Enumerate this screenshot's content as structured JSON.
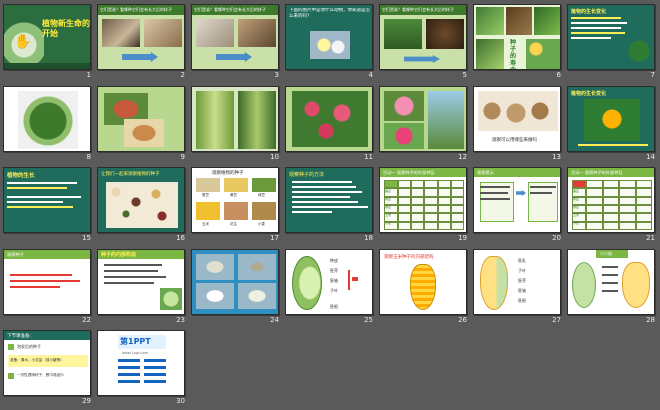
{
  "slides": [
    {
      "num": "1",
      "title": "植物新生命的开始"
    },
    {
      "num": "2",
      "title": "它们是谁？看哪种它们会有长大后的样子"
    },
    {
      "num": "3",
      "title": "它们是谁？看哪种它们会有长大后的样子"
    },
    {
      "num": "4",
      "title": "下面的图片中是你什么动物，你知道是怎么来的吗？"
    },
    {
      "num": "5",
      "title": "它们是谁？看哪种它们会有长大后的样子"
    },
    {
      "num": "6",
      "title": "种子的寿命"
    },
    {
      "num": "7",
      "title": "植物的生长变化"
    },
    {
      "num": "8"
    },
    {
      "num": "9"
    },
    {
      "num": "10"
    },
    {
      "num": "11"
    },
    {
      "num": "12"
    },
    {
      "num": "13",
      "caption": "观察可以用哪些来做吗"
    },
    {
      "num": "14",
      "title": "植物的生长变化"
    },
    {
      "num": "15",
      "title": "植物的生长"
    },
    {
      "num": "16",
      "title": "让我们一起来观察植物的种子"
    },
    {
      "num": "17",
      "title": "观察植物的种子",
      "labels": [
        "蚕豆",
        "黄豆",
        "绿豆",
        "玉米",
        "花生",
        "小麦"
      ]
    },
    {
      "num": "18",
      "title": "观察种子的方法"
    },
    {
      "num": "19",
      "title": "活动一  观察种子的外部特征",
      "rows": [
        "蚕豆",
        "黄豆",
        "绿豆",
        "玉米",
        "小麦"
      ]
    },
    {
      "num": "20",
      "title": "观察提示"
    },
    {
      "num": "21",
      "title": "活动一  观察种子的外部特征",
      "rows": [
        "蚕豆",
        "黄豆",
        "绿豆",
        "玉米",
        "小麦"
      ]
    },
    {
      "num": "22",
      "title": "观察种子"
    },
    {
      "num": "23",
      "title": "种子的内部构造"
    },
    {
      "num": "24"
    },
    {
      "num": "25",
      "labels": [
        "种皮",
        "胚芽",
        "胚轴",
        "子叶",
        "胚根"
      ]
    },
    {
      "num": "26",
      "title": "观察玉米种子的内部结构"
    },
    {
      "num": "27",
      "labels": [
        "胚乳",
        "子叶",
        "胚芽",
        "胚轴",
        "胚根"
      ]
    },
    {
      "num": "28",
      "title": "小小结"
    },
    {
      "num": "29",
      "title": "下节课准备：",
      "items": [
        "泡发后的种子",
        "准备：清水、小花盆（或小罐等）",
        "一次性透明杯子、餐巾或纸巾"
      ]
    },
    {
      "num": "30",
      "title": "第1PPT",
      "subtitle": "www.1ppt.com"
    }
  ],
  "colors": {
    "background": "#5a5a5a",
    "green": "#2e7d32",
    "lightgreen": "#7bb742",
    "teal": "#1f6b5c",
    "red": "#e53935",
    "yellow": "#ffee58"
  }
}
